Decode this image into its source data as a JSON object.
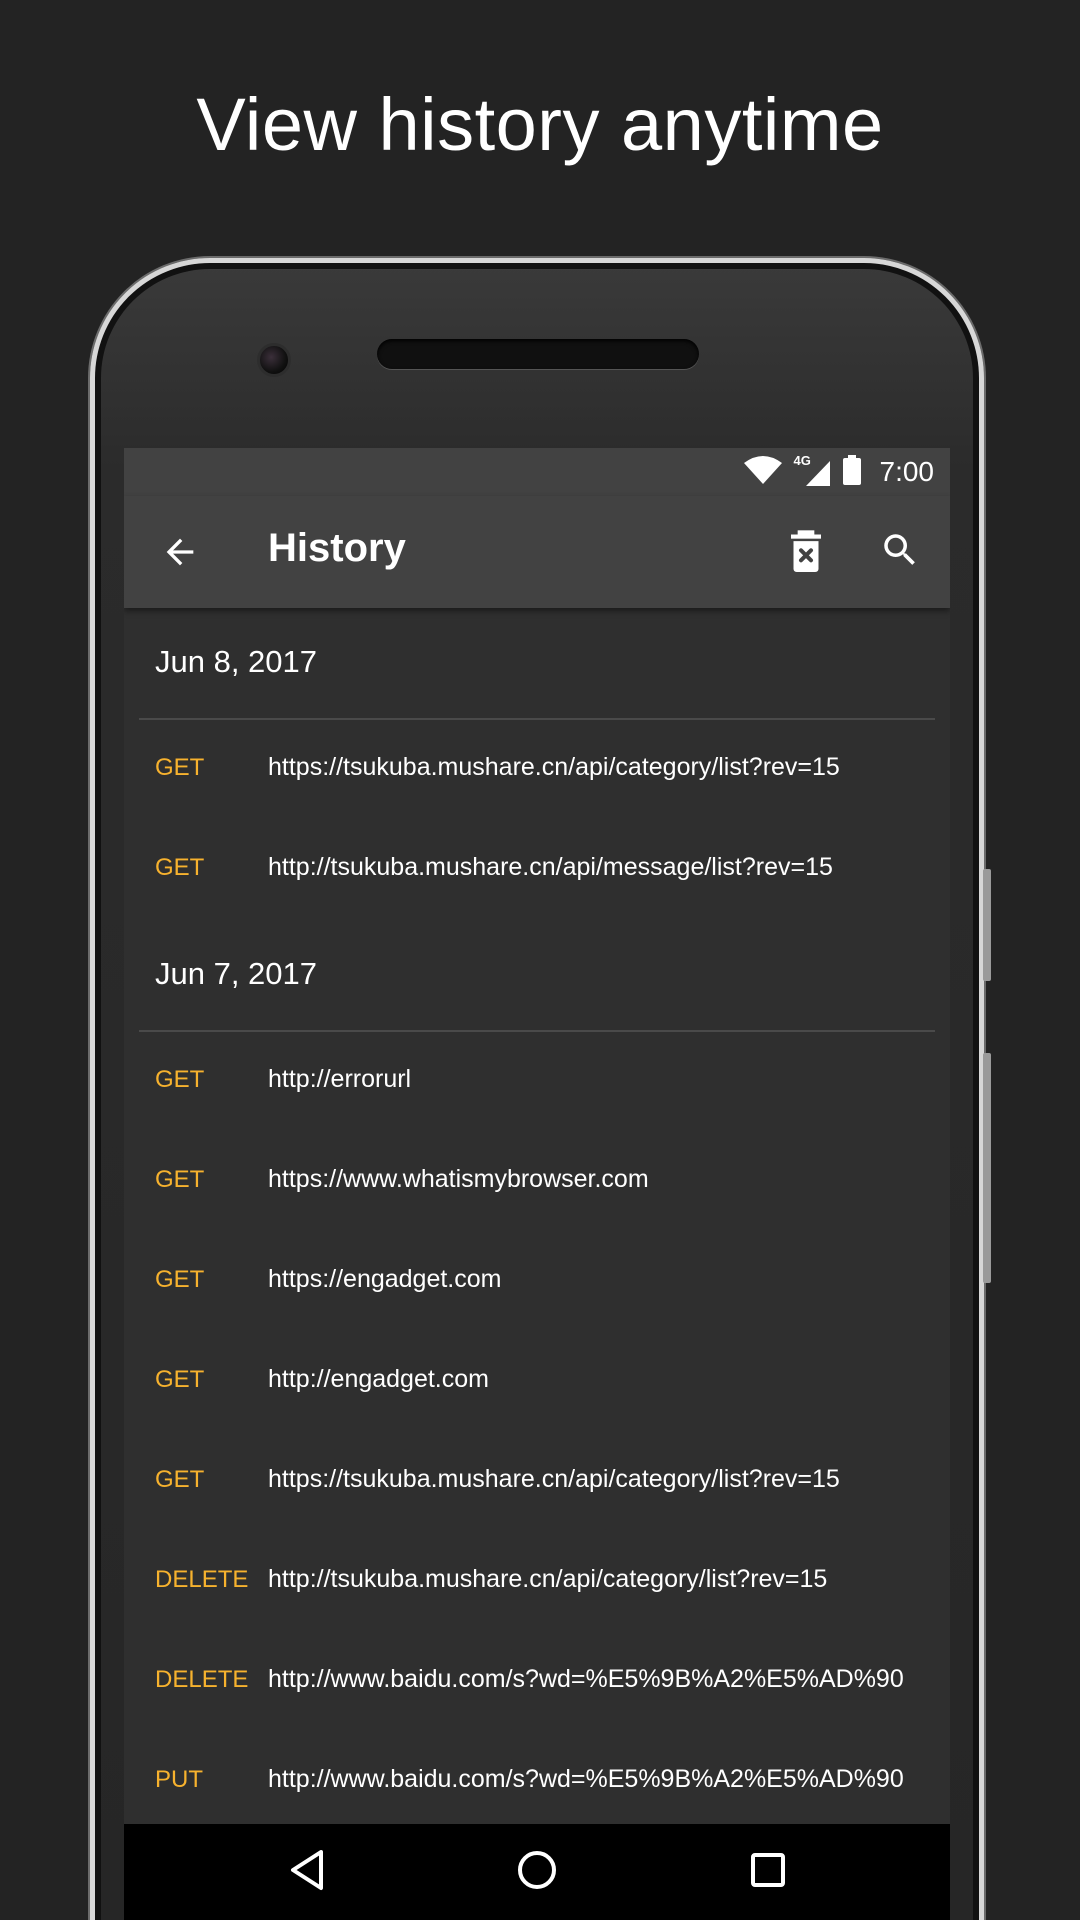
{
  "headline": "View history anytime",
  "status_bar": {
    "network": "4G",
    "time": "7:00",
    "icons": [
      "wifi-icon",
      "signal-icon",
      "battery-icon"
    ]
  },
  "app_bar": {
    "title": "History",
    "back_icon": "arrow-back-icon",
    "actions": [
      "delete-sweep-icon",
      "search-icon"
    ]
  },
  "colors": {
    "method": "#f7b22e",
    "surface": "#2f2f2f",
    "app_bar": "#424242"
  },
  "groups": [
    {
      "date": "Jun 8, 2017",
      "items": [
        {
          "method": "GET",
          "url": "https://tsukuba.mushare.cn/api/category/list?rev=15"
        },
        {
          "method": "GET",
          "url": "http://tsukuba.mushare.cn/api/message/list?rev=15"
        }
      ]
    },
    {
      "date": "Jun 7, 2017",
      "items": [
        {
          "method": "GET",
          "url": "http://errorurl"
        },
        {
          "method": "GET",
          "url": "https://www.whatismybrowser.com"
        },
        {
          "method": "GET",
          "url": "https://engadget.com"
        },
        {
          "method": "GET",
          "url": "http://engadget.com"
        },
        {
          "method": "GET",
          "url": "https://tsukuba.mushare.cn/api/category/list?rev=15"
        },
        {
          "method": "DELETE",
          "url": "http://tsukuba.mushare.cn/api/category/list?rev=15"
        },
        {
          "method": "DELETE",
          "url": "http://www.baidu.com/s?wd=%E5%9B%A2%E5%AD%90"
        },
        {
          "method": "PUT",
          "url": "http://www.baidu.com/s?wd=%E5%9B%A2%E5%AD%90"
        }
      ]
    }
  ],
  "nav_bar": {
    "icons": [
      "back-triangle-icon",
      "home-circle-icon",
      "recents-square-icon"
    ]
  }
}
